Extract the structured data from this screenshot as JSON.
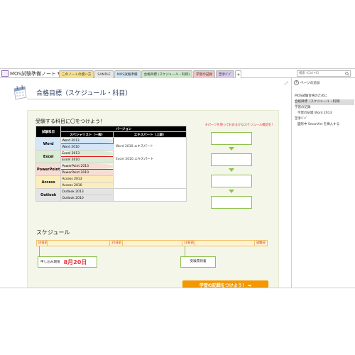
{
  "notebook": {
    "title": "MOS試験準備ノート"
  },
  "tabs": [
    {
      "label": "このノートの使い方",
      "color": "#f5e08c"
    },
    {
      "label": "SAMPLE",
      "color": "#e7e7e7"
    },
    {
      "label": "MOS試験準備",
      "color": "#cfe3f2"
    },
    {
      "label": "合格目標 (スケジュール・科目)",
      "color": "#cbe8c8"
    },
    {
      "label": "学習の記録",
      "color": "#f3c4c4"
    },
    {
      "label": "苦手ｷﾞｷﾞ",
      "color": "#d9c9ec"
    }
  ],
  "search": {
    "placeholder": "検索 (Ctrl+E)"
  },
  "page": {
    "title": "合格目標（スケジュール・科目）",
    "subhead": "受験する科目に〇をつけよう！",
    "side_note": "※パーツを使っておおまかなスケジュール確認を！"
  },
  "table": {
    "h_exam": "試験科目",
    "h_version": "バージョン",
    "h_specialist": "スペシャリスト（一般）",
    "h_expert": "エキスパート（上級）",
    "categories": [
      "Word",
      "Excel",
      "PowerPoint",
      "Access",
      "Outlook"
    ],
    "specialist": [
      "Word 2013",
      "Word 2010",
      "Excel 2013",
      "Excel 2010",
      "PowerPoint 2013",
      "PowerPoint 2010",
      "Access 2013",
      "Access 2010",
      "Outlook 2013",
      "Outlook 2010"
    ],
    "expert": [
      "Word 2010 エキスパート",
      "Excel 2010 エキスパート"
    ]
  },
  "schedule": {
    "title": "スケジュール",
    "ticks": [
      "30日前",
      "20日前",
      "10日前",
      "試験日"
    ],
    "deadline_label": "申し込み期限",
    "deadline_date": "8月20日",
    "review_label": "受験票到着"
  },
  "cta": {
    "label": "学習の記録をつけよう！"
  },
  "right_pane": {
    "add_page": "ページの追加",
    "pages": [
      {
        "label": "MOS試験合格のために",
        "indent": false,
        "selected": false
      },
      {
        "label": "合格目標（スケジュール・科目）",
        "indent": false,
        "selected": true
      },
      {
        "label": "学習の記録",
        "indent": false,
        "selected": false
      },
      {
        "label": "学習の記録 Word 2013",
        "indent": true,
        "selected": false
      },
      {
        "label": "苦手ｷﾞｷﾞ",
        "indent": false,
        "selected": false
      },
      {
        "label": "図形中 SmartArt を挿入する",
        "indent": true,
        "selected": false
      }
    ]
  },
  "colors": {
    "accent_orange": "#f39800",
    "circle_red": "#e01a22",
    "flow_green": "#8fc24c"
  }
}
